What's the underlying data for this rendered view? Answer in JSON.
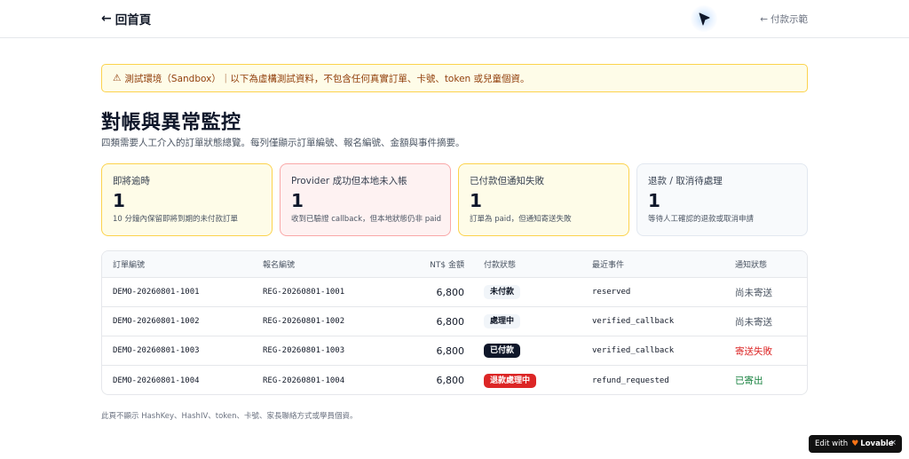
{
  "header": {
    "back_label": "回首頁",
    "pay_demo_label": "付款示範"
  },
  "banner": {
    "text": "測試環境（Sandbox）｜以下為虛構測試資料，不包含任何真實訂單、卡號、token 或兒童個資。"
  },
  "page": {
    "title": "對帳與異常監控",
    "subtitle": "四類需要人工介入的訂單狀態總覽。每列僅顯示訂單編號、報名編號、金額與事件摘要。"
  },
  "cards": [
    {
      "title": "即將逾時",
      "count": "1",
      "desc": "10 分鐘內保留即將到期的未付款訂單"
    },
    {
      "title": "Provider 成功但本地未入帳",
      "count": "1",
      "desc": "收到已驗證 callback，但本地狀態仍非 paid"
    },
    {
      "title": "已付款但通知失敗",
      "count": "1",
      "desc": "訂單為 paid，但通知寄送失敗"
    },
    {
      "title": "退款 / 取消待處理",
      "count": "1",
      "desc": "等待人工確認的退款或取消申請"
    }
  ],
  "table": {
    "headers": [
      "訂單編號",
      "報名編號",
      "NT$ 金額",
      "付款狀態",
      "最近事件",
      "通知狀態"
    ],
    "rows": [
      {
        "order": "DEMO-20260801-1001",
        "registration": "REG-20260801-1001",
        "amount": "6,800",
        "payment_status": "未付款",
        "event": "reserved",
        "notify": "尚未寄送"
      },
      {
        "order": "DEMO-20260801-1002",
        "registration": "REG-20260801-1002",
        "amount": "6,800",
        "payment_status": "處理中",
        "event": "verified_callback",
        "notify": "尚未寄送"
      },
      {
        "order": "DEMO-20260801-1003",
        "registration": "REG-20260801-1003",
        "amount": "6,800",
        "payment_status": "已付款",
        "event": "verified_callback",
        "notify": "寄送失敗"
      },
      {
        "order": "DEMO-20260801-1004",
        "registration": "REG-20260801-1004",
        "amount": "6,800",
        "payment_status": "退款處理中",
        "event": "refund_requested",
        "notify": "已寄出"
      }
    ]
  },
  "footer": {
    "note": "此頁不顯示 HashKey、HashIV、token、卡號、家長聯絡方式或學員個資。"
  },
  "lovable": {
    "prefix": "Edit with",
    "brand": "Lovable",
    "close": "×"
  },
  "colors": {
    "warning_bg": "#fefce8",
    "warning_border": "#fcd34d",
    "danger": "#dc2626",
    "success": "#15803d",
    "dark": "#0f172a"
  },
  "icons": {
    "back": "arrow-left-icon",
    "pay_demo": "arrow-left-icon",
    "banner": "warning-icon",
    "cursor": "mouse-pointer-icon",
    "lovable": "heart-icon"
  }
}
